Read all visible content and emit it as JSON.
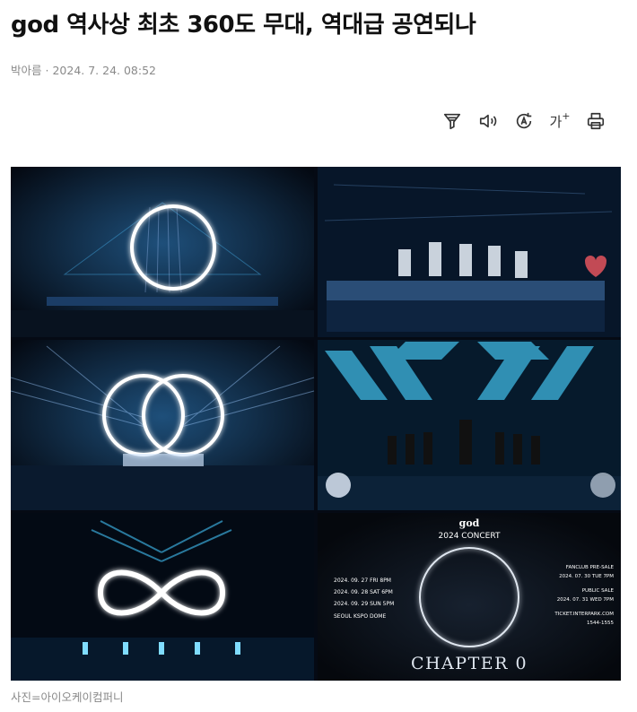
{
  "article": {
    "headline": "god 역사상 최초 360도 무대, 역대급 공연되나",
    "author": "박아름",
    "separator": "·",
    "timestamp": "2024. 7. 24. 08:52",
    "caption": "사진=아이오케이컴퍼니"
  },
  "toolbar": {
    "items": [
      {
        "name": "summary-icon"
      },
      {
        "name": "speaker-icon"
      },
      {
        "name": "translate-icon"
      },
      {
        "name": "font-size-icon",
        "label": "가"
      },
      {
        "name": "print-icon"
      }
    ]
  },
  "poster": {
    "brand": "god",
    "concert": "2024 CONCERT",
    "dates": [
      "2024. 09. 27 FRI 8PM",
      "2024. 09. 28 SAT 6PM",
      "2024. 09. 29 SUN 5PM"
    ],
    "venue": "SEOUL KSPO DOME",
    "fanclub_label": "FANCLUB PRE-SALE",
    "fanclub_date": "2024. 07. 30 TUE 7PM",
    "public_label": "PUBLIC SALE",
    "public_date": "2024. 07. 31 WED 7PM",
    "ticket_site": "TICKET.INTERPARK.COM",
    "phone": "1544-1555",
    "chapter": "CHAPTER 0"
  },
  "colors": {
    "stage_bg": "#050a14",
    "light_blue": "#3fb7e0",
    "glow": "#ffffff",
    "byline": "#8a8a8a"
  }
}
